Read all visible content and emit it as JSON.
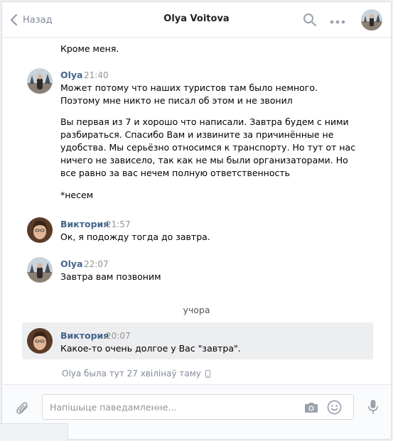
{
  "header": {
    "back_label": "Назад",
    "title": "Olya Voitova"
  },
  "history": {
    "top_continuation": "Кроме меня.",
    "messages": [
      {
        "author": "Olya",
        "time": "21:40",
        "lines": [
          "Может потому что наших туристов там было немного.",
          "Поэтому мне никто не писал об этом и не звонил",
          "Вы первая из 7 и хорошо что написали. Завтра будем с ними",
          "разбираться. Спасибо Вам и извините за причинённые не",
          "удобства. Мы серьёзно относимся к транспорту. Но тут от нас",
          "ничего не зависело, так как не мы были организаторами. Но",
          "все равно за вас нечем полную ответственность",
          "*несем"
        ]
      },
      {
        "author": "Виктория",
        "time": "21:57",
        "lines": [
          "Ок, я подожду тогда до завтра."
        ]
      },
      {
        "author": "Olya",
        "time": "22:07",
        "lines": [
          "Завтра вам позвоним"
        ]
      },
      {
        "author": "Виктория",
        "time": "20:07",
        "lines": [
          "Какое-то очень долгое у Вас \"завтра\"."
        ]
      }
    ],
    "day_divider": "учора",
    "seen_status": "Olya была тут 27 хвілінаў таму"
  },
  "composer": {
    "placeholder": "Напішыце паведамленне..."
  },
  "icons": {
    "back": "chevron-left-icon",
    "search": "search-icon",
    "more": "more-dots-icon",
    "attach": "paperclip-icon",
    "camera": "camera-icon",
    "emoji": "smile-icon",
    "mic": "microphone-icon",
    "mobile": "phone-icon"
  },
  "colors": {
    "author": "#42648b",
    "muted": "#939393",
    "highlight": "#edeef0",
    "icon": "#99a2ad"
  }
}
